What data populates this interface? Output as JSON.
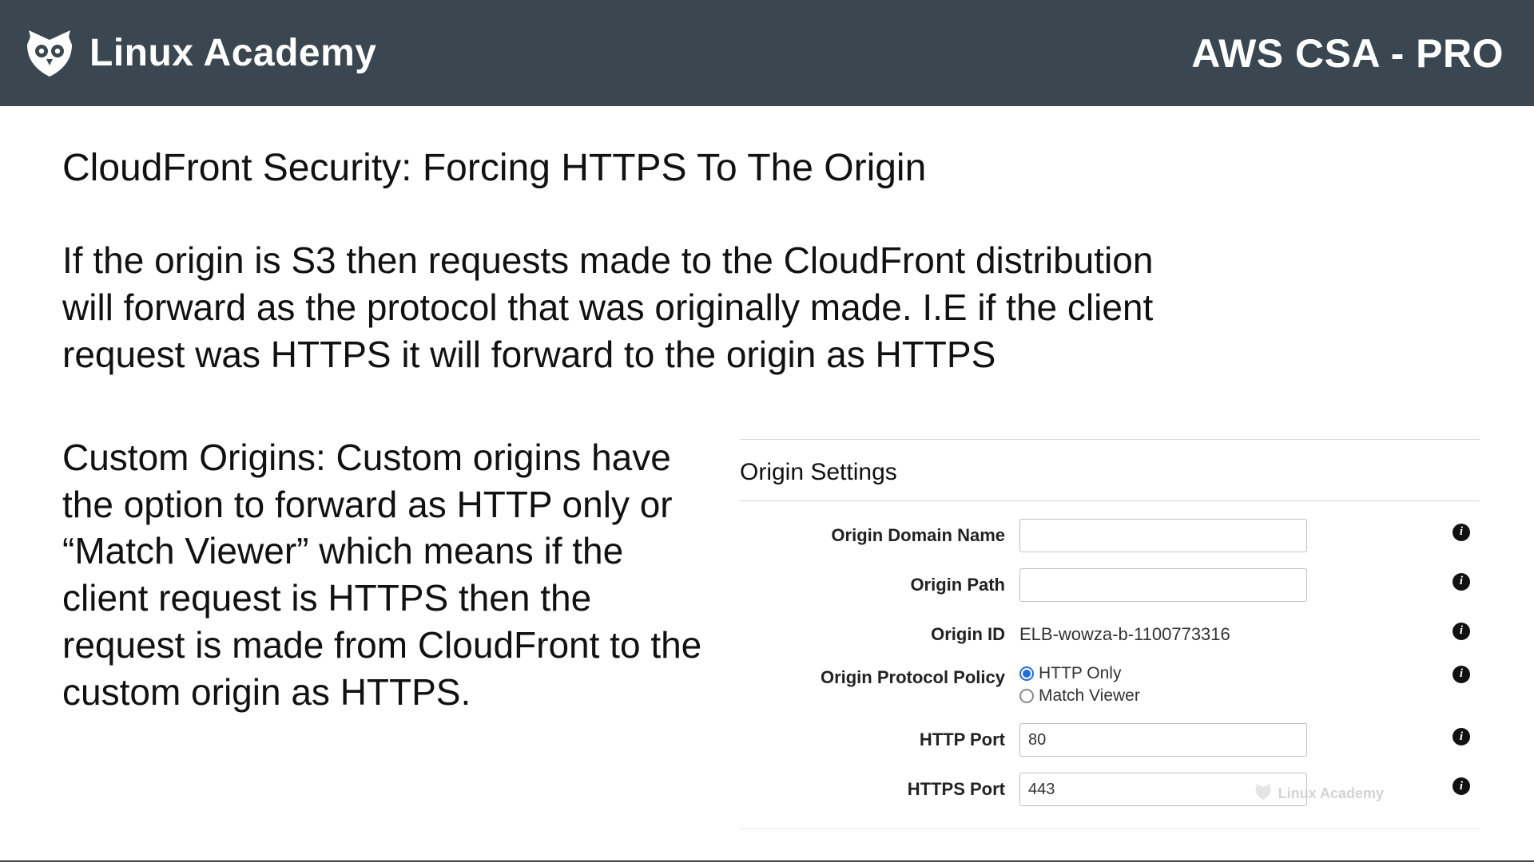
{
  "header": {
    "brand": "Linux Academy",
    "course": "AWS CSA - PRO"
  },
  "slide": {
    "title": "CloudFront Security:  Forcing HTTPS To The Origin",
    "para1": "If the origin is S3 then requests made to the CloudFront distribution will forward as the protocol that was originally made. I.E if the client request was HTTPS it will forward to the origin as HTTPS",
    "para2": "Custom Origins: Custom origins have the option to forward as HTTP only or “Match Viewer” which means if the client request is HTTPS then the request is made from CloudFront to the custom origin as HTTPS."
  },
  "panel": {
    "title": "Origin Settings",
    "fields": {
      "domain_name": {
        "label": "Origin Domain Name",
        "value": ""
      },
      "path": {
        "label": "Origin Path",
        "value": ""
      },
      "origin_id": {
        "label": "Origin ID",
        "value": "ELB-wowza-b-1100773316"
      },
      "protocol": {
        "label": "Origin Protocol Policy",
        "options": [
          "HTTP Only",
          "Match Viewer"
        ],
        "selected": "HTTP Only"
      },
      "http_port": {
        "label": "HTTP Port",
        "value": "80"
      },
      "https_port": {
        "label": "HTTPS Port",
        "value": "443"
      }
    }
  },
  "watermark": "Linux Academy",
  "icons": {
    "info": "i"
  }
}
